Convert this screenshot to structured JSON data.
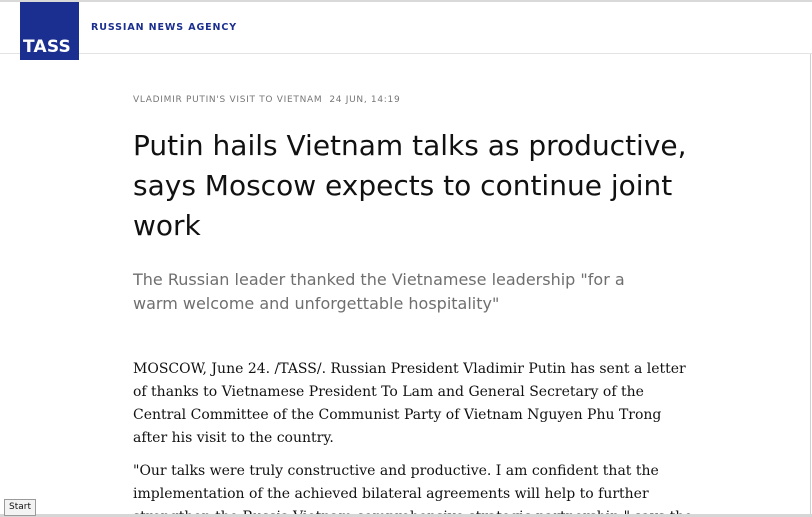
{
  "header": {
    "logo_text": "TASS",
    "agency_label": "RUSSIAN NEWS AGENCY"
  },
  "article": {
    "section": "VLADIMIR PUTIN'S VISIT TO VIETNAM",
    "date": "24 JUN, 14:19",
    "headline": "Putin hails Vietnam talks as productive, says Moscow expects to continue joint work",
    "subtitle": "The Russian leader thanked the Vietnamese leadership \"for a warm welcome and unforgettable hospitality\"",
    "paragraphs": [
      "MOSCOW, June 24. /TASS/. Russian President Vladimir Putin has sent a letter of thanks to Vietnamese President To Lam and General Secretary of the Central Committee of the Communist Party of Vietnam Nguyen Phu Trong after his visit to the country.",
      "\"Our talks were truly constructive and productive. I am confident that the implementation of the achieved bilateral agreements will help to further strengthen the Russia-Vietnam comprehensive strategic partnership,\" says the"
    ]
  },
  "taskbar": {
    "start_label": "Start"
  },
  "colors": {
    "brand": "#1a2f8f",
    "text": "#111111",
    "muted": "#6f6f6f"
  }
}
